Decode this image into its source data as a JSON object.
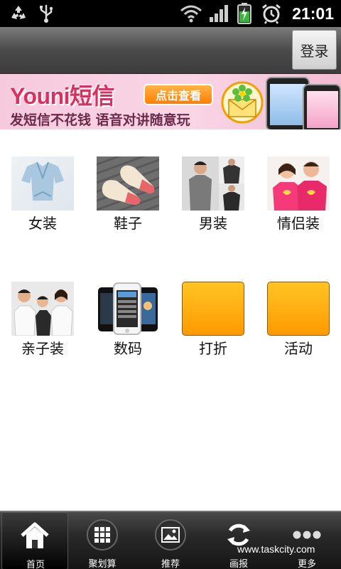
{
  "status_bar": {
    "time": "21:01",
    "icons": [
      "recycle-icon",
      "usb-icon",
      "wifi-icon",
      "signal-icon",
      "battery-charging-icon",
      "alarm-icon"
    ]
  },
  "header": {
    "login_label": "登录"
  },
  "banner": {
    "brand": "Youni短信",
    "cta": "点击查看",
    "tagline": "发短信不花钱 语音对讲随意玩"
  },
  "categories": [
    {
      "label": "女装",
      "icon": "womens-clothing-photo"
    },
    {
      "label": "鞋子",
      "icon": "shoes-photo"
    },
    {
      "label": "男装",
      "icon": "mens-clothing-photo"
    },
    {
      "label": "情侣装",
      "icon": "couples-clothing-photo"
    },
    {
      "label": "亲子装",
      "icon": "family-clothing-photo"
    },
    {
      "label": "数码",
      "icon": "digital-phones-photo"
    },
    {
      "label": "打折",
      "icon": "orange-square"
    },
    {
      "label": "活动",
      "icon": "orange-square"
    }
  ],
  "tabbar": {
    "tabs": [
      {
        "label": "首页",
        "icon": "home-icon",
        "active": true
      },
      {
        "label": "聚划算",
        "icon": "grid-icon",
        "active": false
      },
      {
        "label": "推荐",
        "icon": "picture-icon",
        "active": false
      },
      {
        "label": "画报",
        "icon": "refresh-icon",
        "active": false
      },
      {
        "label": "更多",
        "icon": "more-dots-icon",
        "active": false
      }
    ],
    "watermark": "www.taskcity.com"
  },
  "colors": {
    "orange_tile": "#ffb000",
    "banner_pink": "#f7c9dd",
    "brand_red": "#d8305f"
  }
}
